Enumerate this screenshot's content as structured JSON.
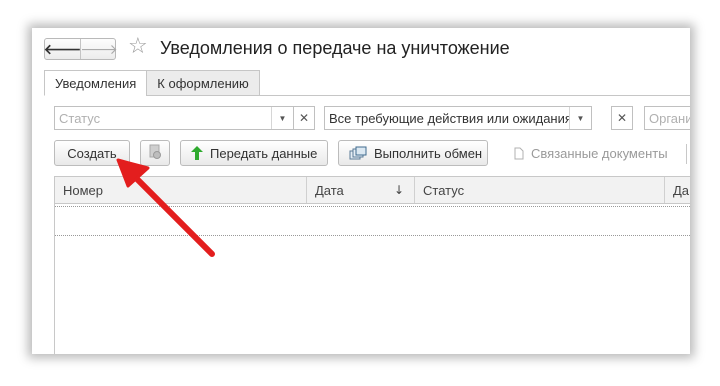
{
  "window": {
    "title": "Уведомления о передаче на уничтожение",
    "nav": {
      "back_icon": "arrow-left-icon",
      "forward_icon": "arrow-right-icon",
      "favorite_icon": "star-icon"
    }
  },
  "tabs": [
    {
      "label": "Уведомления",
      "active": true
    },
    {
      "label": "К оформлению",
      "active": false
    }
  ],
  "filters": {
    "status": {
      "placeholder": "Статус",
      "value": ""
    },
    "action": {
      "value": "Все требующие действия или ожидания"
    },
    "organization": {
      "placeholder": "Органи"
    }
  },
  "toolbar": {
    "create_label": "Создать",
    "transfer_label": "Передать данные",
    "exchange_label": "Выполнить обмен",
    "related_label": "Связанные документы"
  },
  "table": {
    "columns": [
      "Номер",
      "Дата",
      "Статус",
      "Да"
    ],
    "sort_indicator": "↓"
  },
  "colors": {
    "annotation_arrow": "#e31e1e",
    "transfer_icon": "#2eaa2e"
  }
}
